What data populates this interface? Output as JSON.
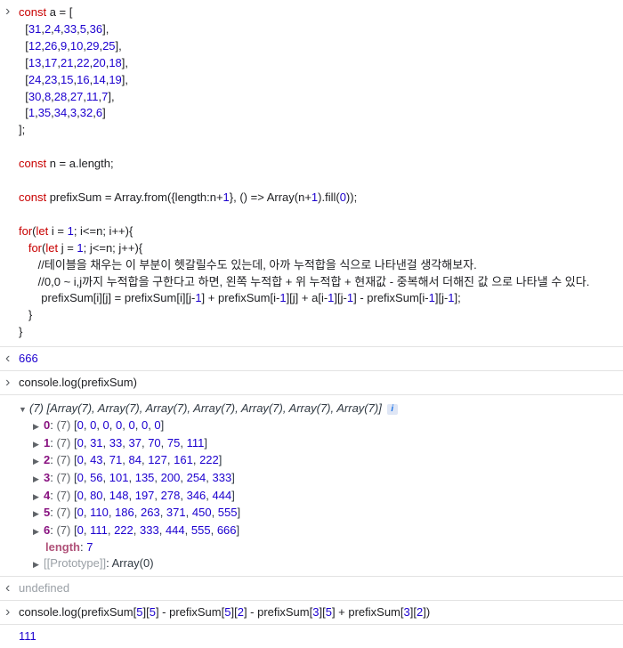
{
  "entries": {
    "code": {
      "lines": [
        "const a = [",
        "  [31,2,4,33,5,36],",
        "  [12,26,9,10,29,25],",
        "  [13,17,21,22,20,18],",
        "  [24,23,15,16,14,19],",
        "  [30,8,28,27,11,7],",
        "  [1,35,34,3,32,6]",
        "];",
        "",
        "const n = a.length;",
        "",
        "const prefixSum = Array.from({length:n+1}, () => Array(n+1).fill(0));",
        "",
        "for(let i = 1; i<=n; i++){",
        "   for(let j = 1; j<=n; j++){",
        "      //테이블을 채우는 이 부분이 헷갈릴수도 있는데, 아까 누적합을 식으로 나타낸걸 생각해보자.",
        "      //0,0 ~ i,j까지 누적합을 구한다고 하면, 왼쪽 누적합 + 위 누적합 + 현재값 - 중복해서 더해진 값 으로 나타낼 수 있다.",
        "       prefixSum[i][j] = prefixSum[i][j-1] + prefixSum[i-1][j] + a[i-1][j-1] - prefixSum[i-1][j-1];",
        "   }",
        "}"
      ]
    },
    "result1": "666",
    "log1": "console.log(prefixSum)",
    "array_summary": "(7) [Array(7), Array(7), Array(7), Array(7), Array(7), Array(7), Array(7)]",
    "info_icon": "i",
    "rows": [
      {
        "key": "0",
        "count": "(7)",
        "values": "[0, 0, 0, 0, 0, 0, 0]"
      },
      {
        "key": "1",
        "count": "(7)",
        "values": "[0, 31, 33, 37, 70, 75, 111]"
      },
      {
        "key": "2",
        "count": "(7)",
        "values": "[0, 43, 71, 84, 127, 161, 222]"
      },
      {
        "key": "3",
        "count": "(7)",
        "values": "[0, 56, 101, 135, 200, 254, 333]"
      },
      {
        "key": "4",
        "count": "(7)",
        "values": "[0, 80, 148, 197, 278, 346, 444]"
      },
      {
        "key": "5",
        "count": "(7)",
        "values": "[0, 110, 186, 263, 371, 450, 555]"
      },
      {
        "key": "6",
        "count": "(7)",
        "values": "[0, 111, 222, 333, 444, 555, 666]"
      }
    ],
    "length_key": "length",
    "length_value": "7",
    "proto_key": "[[Prototype]]",
    "proto_value": "Array(0)",
    "result2": "undefined",
    "log2": "console.log(prefixSum[5][5] - prefixSum[5][2] - prefixSum[3][5] + prefixSum[3][2])",
    "result3": "111"
  }
}
